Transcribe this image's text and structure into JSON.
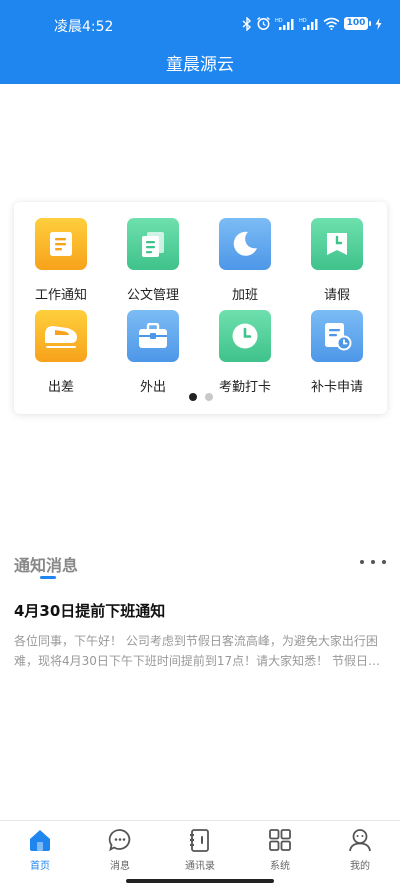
{
  "status_bar": {
    "time": "凌晨4:52",
    "battery": "100"
  },
  "app_title": "童晨源云",
  "functions": [
    {
      "label": "工作通知",
      "icon": "document-icon",
      "color": "#f7a21a"
    },
    {
      "label": "公文管理",
      "icon": "files-icon",
      "color": "#3fc28b"
    },
    {
      "label": "加班",
      "icon": "moon-icon",
      "color": "#4d97e8"
    },
    {
      "label": "请假",
      "icon": "leave-calendar-icon",
      "color": "#3fc28b"
    },
    {
      "label": "出差",
      "icon": "train-icon",
      "color": "#f7a21a"
    },
    {
      "label": "外出",
      "icon": "briefcase-icon",
      "color": "#4d97e8"
    },
    {
      "label": "考勤打卡",
      "icon": "clock-icon",
      "color": "#3fc28b"
    },
    {
      "label": "补卡申请",
      "icon": "card-apply-icon",
      "color": "#4d97e8"
    }
  ],
  "pager": {
    "pages": 2,
    "active": 0
  },
  "notice": {
    "section_title": "通知消息",
    "item_title": "4月30日提前下班通知",
    "item_body": "各位同事，下午好！ 公司考虑到节假日客流高峰，为避免大家出行困难，现将4月30日下午下班时间提前到17点！请大家知悉！ 节假日…"
  },
  "tabs": [
    {
      "label": "首页",
      "icon": "home-icon",
      "active": true
    },
    {
      "label": "消息",
      "icon": "chat-icon",
      "active": false
    },
    {
      "label": "通讯录",
      "icon": "contacts-icon",
      "active": false
    },
    {
      "label": "系统",
      "icon": "grid-icon",
      "active": false
    },
    {
      "label": "我的",
      "icon": "profile-icon",
      "active": false
    }
  ],
  "colors": {
    "brand": "#1f86f0",
    "orange": "#f7a21a",
    "green": "#3fc28b",
    "blue": "#4d97e8"
  }
}
